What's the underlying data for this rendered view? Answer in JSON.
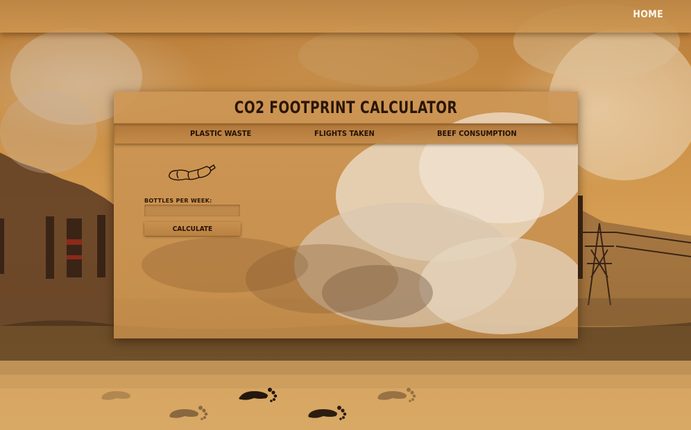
{
  "nav": {
    "home_label": "HOME"
  },
  "calculator": {
    "title": "CO2 FOOTPRINT CALCULATOR",
    "tabs": [
      {
        "label": "PLASTIC WASTE"
      },
      {
        "label": "FLIGHTS TAKEN"
      },
      {
        "label": "BEEF CONSUMPTION"
      }
    ],
    "active_tab": "PLASTIC WASTE",
    "form": {
      "field_label": "BOTTLES PER WEEK:",
      "input_value": "",
      "button_label": "CALCULATE"
    },
    "icon": "plastic-bottle-icon"
  },
  "colors": {
    "background_tone": "#c98e45",
    "panel": "#cd9655",
    "text_dark": "#2a1608",
    "nav_text": "#fff8ec"
  }
}
